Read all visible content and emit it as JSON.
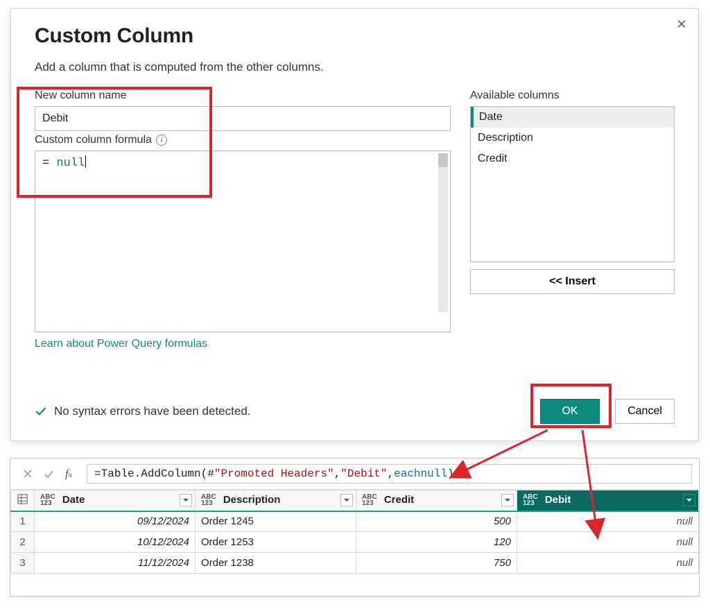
{
  "dialog": {
    "title": "Custom Column",
    "subtitle": "Add a column that is computed from the other columns.",
    "new_col_label": "New column name",
    "new_col_value": "Debit",
    "formula_label": "Custom column formula",
    "formula_prefix": "= ",
    "formula_token": "null",
    "avail_label": "Available columns",
    "avail_items": [
      "Date",
      "Description",
      "Credit"
    ],
    "insert_label": "<< Insert",
    "learn_link": "Learn about Power Query formulas",
    "status_text": "No syntax errors have been detected.",
    "ok_label": "OK",
    "cancel_label": "Cancel"
  },
  "fxbar": {
    "prefix": "= ",
    "fn": "Table.AddColumn",
    "open": "(",
    "arg1a": "#",
    "arg1b": "\"Promoted Headers\"",
    "sep1": ", ",
    "arg2": "\"Debit\"",
    "sep2": ", ",
    "kw": "each",
    "space": " ",
    "nulltk": "null",
    "close": ")"
  },
  "grid": {
    "type_tag_top": "ABC",
    "type_tag_bot": "123",
    "headers": {
      "date": "Date",
      "desc": "Description",
      "credit": "Credit",
      "debit": "Debit"
    },
    "rows": [
      {
        "n": "1",
        "date": "09/12/2024",
        "desc": "Order 1245",
        "credit": "500",
        "debit": "null"
      },
      {
        "n": "2",
        "date": "10/12/2024",
        "desc": "Order 1253",
        "credit": "120",
        "debit": "null"
      },
      {
        "n": "3",
        "date": "11/12/2024",
        "desc": "Order 1238",
        "credit": "750",
        "debit": "null"
      }
    ]
  }
}
